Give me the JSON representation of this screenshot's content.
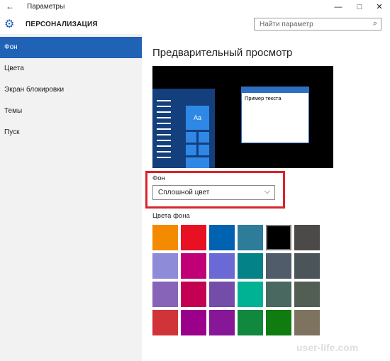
{
  "window": {
    "title": "Параметры",
    "back_icon": "back-arrow-icon",
    "controls": [
      "—",
      "□",
      "✕"
    ]
  },
  "header": {
    "page_title": "ПЕРСОНАЛИЗАЦИЯ",
    "search_placeholder": "Найти параметр"
  },
  "sidebar": {
    "items": [
      {
        "label": "Фон",
        "active": true
      },
      {
        "label": "Цвета",
        "active": false
      },
      {
        "label": "Экран блокировки",
        "active": false
      },
      {
        "label": "Темы",
        "active": false
      },
      {
        "label": "Пуск",
        "active": false
      }
    ]
  },
  "main": {
    "heading": "Предварительный просмотр",
    "preview_text": "Пример текста",
    "preview_tile_text": "Aa",
    "background_label": "Фон",
    "background_value": "Сплошной цвет",
    "colors_label": "Цвета фона",
    "colors": [
      "#f38a00",
      "#e81123",
      "#0063b1",
      "#2d7d9a",
      "#000000",
      "#4c4a48",
      "#8e8cd8",
      "#bf0077",
      "#6b69d6",
      "#038387",
      "#515c6b",
      "#4a5459",
      "#8764b8",
      "#c30052",
      "#744da9",
      "#00b294",
      "#486860",
      "#525e54",
      "#d13438",
      "#9a0089",
      "#881798",
      "#10893e",
      "#107c10",
      "#7e735f"
    ],
    "selected_color": "#000000"
  },
  "accent": "#1f62b6",
  "watermark": "user-life.com"
}
